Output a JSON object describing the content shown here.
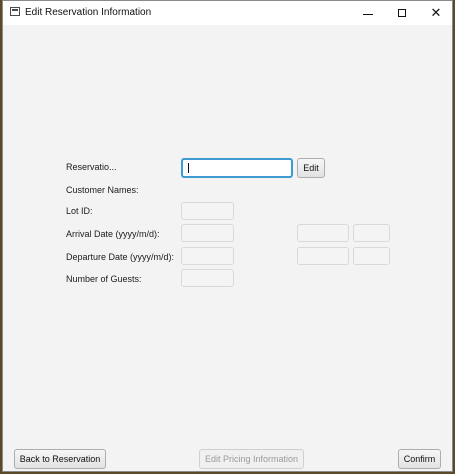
{
  "window": {
    "title": "Edit Reservation Information",
    "minimize_glyph": "–",
    "maximize_glyph": "□",
    "close_glyph": "✕"
  },
  "form": {
    "reservation_label": "Reservatio...",
    "reservation_value": "",
    "edit_button": "Edit",
    "customer_names_label": "Customer Names:",
    "lot_id_label": "Lot ID:",
    "arrival_label": "Arrival Date (yyyy/m/d):",
    "departure_label": "Departure Date (yyyy/m/d):",
    "guests_label": "Number of Guests:"
  },
  "footer": {
    "back_button": "Back to Reservation",
    "pricing_button": "Edit Pricing Information",
    "confirm_button": "Confirm"
  }
}
